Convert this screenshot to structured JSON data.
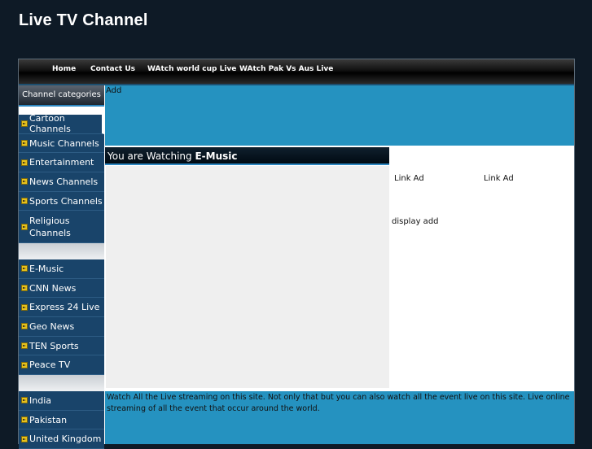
{
  "site": {
    "title": "Live TV Channel"
  },
  "nav": {
    "items": [
      "Home",
      "Contact Us",
      "WAtch world cup Live",
      "WAtch Pak Vs Aus Live"
    ]
  },
  "sidebar": {
    "header": "Channel categories",
    "categories": [
      "Cartoon Channels",
      "Music Channels",
      "Entertainment",
      "News Channels",
      "Sports Channels",
      "Religious Channels"
    ],
    "channels": [
      "E-Music",
      "CNN News",
      "Express 24 Live",
      "Geo News",
      "TEN Sports",
      "Peace TV"
    ],
    "countries": [
      "India",
      "Pakistan",
      "United Kingdom"
    ]
  },
  "ads": {
    "top_label": "Add",
    "link_ad_1": "Link Ad",
    "link_ad_2": "Link Ad",
    "display_ad": "display add"
  },
  "watching": {
    "prefix": "You are Watching ",
    "channel": "E-Music"
  },
  "footer": {
    "text": "Watch All the Live streaming on this site. Not only that but you can also watch all the event live on this site. Live online streaming of all the event that occur around the world."
  },
  "colors": {
    "page_bg": "#0e1a26",
    "sidebar_bg": "#19446a",
    "accent_blue": "#2592c0",
    "bullet_yellow": "#e8c21b"
  }
}
